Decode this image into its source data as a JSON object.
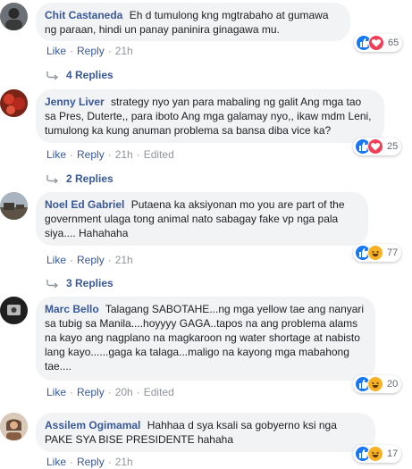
{
  "comments": [
    {
      "author": "Chit Castaneda",
      "text": "Eh d tumulong kng mgtrabaho at gumawa ng paraan, hindi un panay paninira ginagawa mu.",
      "actions": {
        "like": "Like",
        "reply": "Reply",
        "time": "21h",
        "edited": ""
      },
      "reactions": [
        "like-icon",
        "love-icon"
      ],
      "reaction_count": "65",
      "replies_label": "4 Replies"
    },
    {
      "author": "Jenny Liver",
      "text": "strategy nyo yan para mabaling ng galit Ang mga tao sa Pres, Duterte,, para iboto Ang mga galamay nyo,, ikaw mdm Leni, tumulong ka kung anuman problema sa bansa diba vice ka?",
      "actions": {
        "like": "Like",
        "reply": "Reply",
        "time": "21h",
        "edited": "Edited"
      },
      "reactions": [
        "like-icon",
        "love-icon"
      ],
      "reaction_count": "25",
      "replies_label": "2 Replies"
    },
    {
      "author": "Noel Ed Gabriel",
      "text": "Putaena ka aksiyonan mo you are part of the government ulaga tong animal nato sabagay fake vp nga pala siya.... Hahahaha",
      "actions": {
        "like": "Like",
        "reply": "Reply",
        "time": "21h",
        "edited": ""
      },
      "reactions": [
        "like-icon",
        "haha-icon"
      ],
      "reaction_count": "77",
      "replies_label": "3 Replies"
    },
    {
      "author": "Marc Bello",
      "text": "Talagang SABOTAHE...ng mga yellow tae ang nanyari sa tubig sa Manila....hoyyyy GAGA..tapos na ang problema alams na kayo ang nagplano na magkaroon ng water shortage at nabisto lang kayo......gaga ka talaga...maligo na kayong mga mabahong tae....",
      "actions": {
        "like": "Like",
        "reply": "Reply",
        "time": "20h",
        "edited": "Edited"
      },
      "reactions": [
        "like-icon",
        "haha-icon"
      ],
      "reaction_count": "20",
      "replies_label": ""
    },
    {
      "author": "Assilem Ogimamal",
      "text": "Hahhaa d sya ksali sa gobyerno ksi nga PAKE SYA BISE PRESIDENTE hahaha",
      "actions": {
        "like": "Like",
        "reply": "Reply",
        "time": "21h",
        "edited": ""
      },
      "reactions": [
        "like-icon",
        "haha-icon"
      ],
      "reaction_count": "17",
      "replies_label": ""
    }
  ],
  "colors": {
    "link": "#385898",
    "muted": "#90949c",
    "bubble": "#f2f3f5",
    "like": "#1877f2",
    "love": "#f33e58",
    "haha": "#f7b125"
  }
}
